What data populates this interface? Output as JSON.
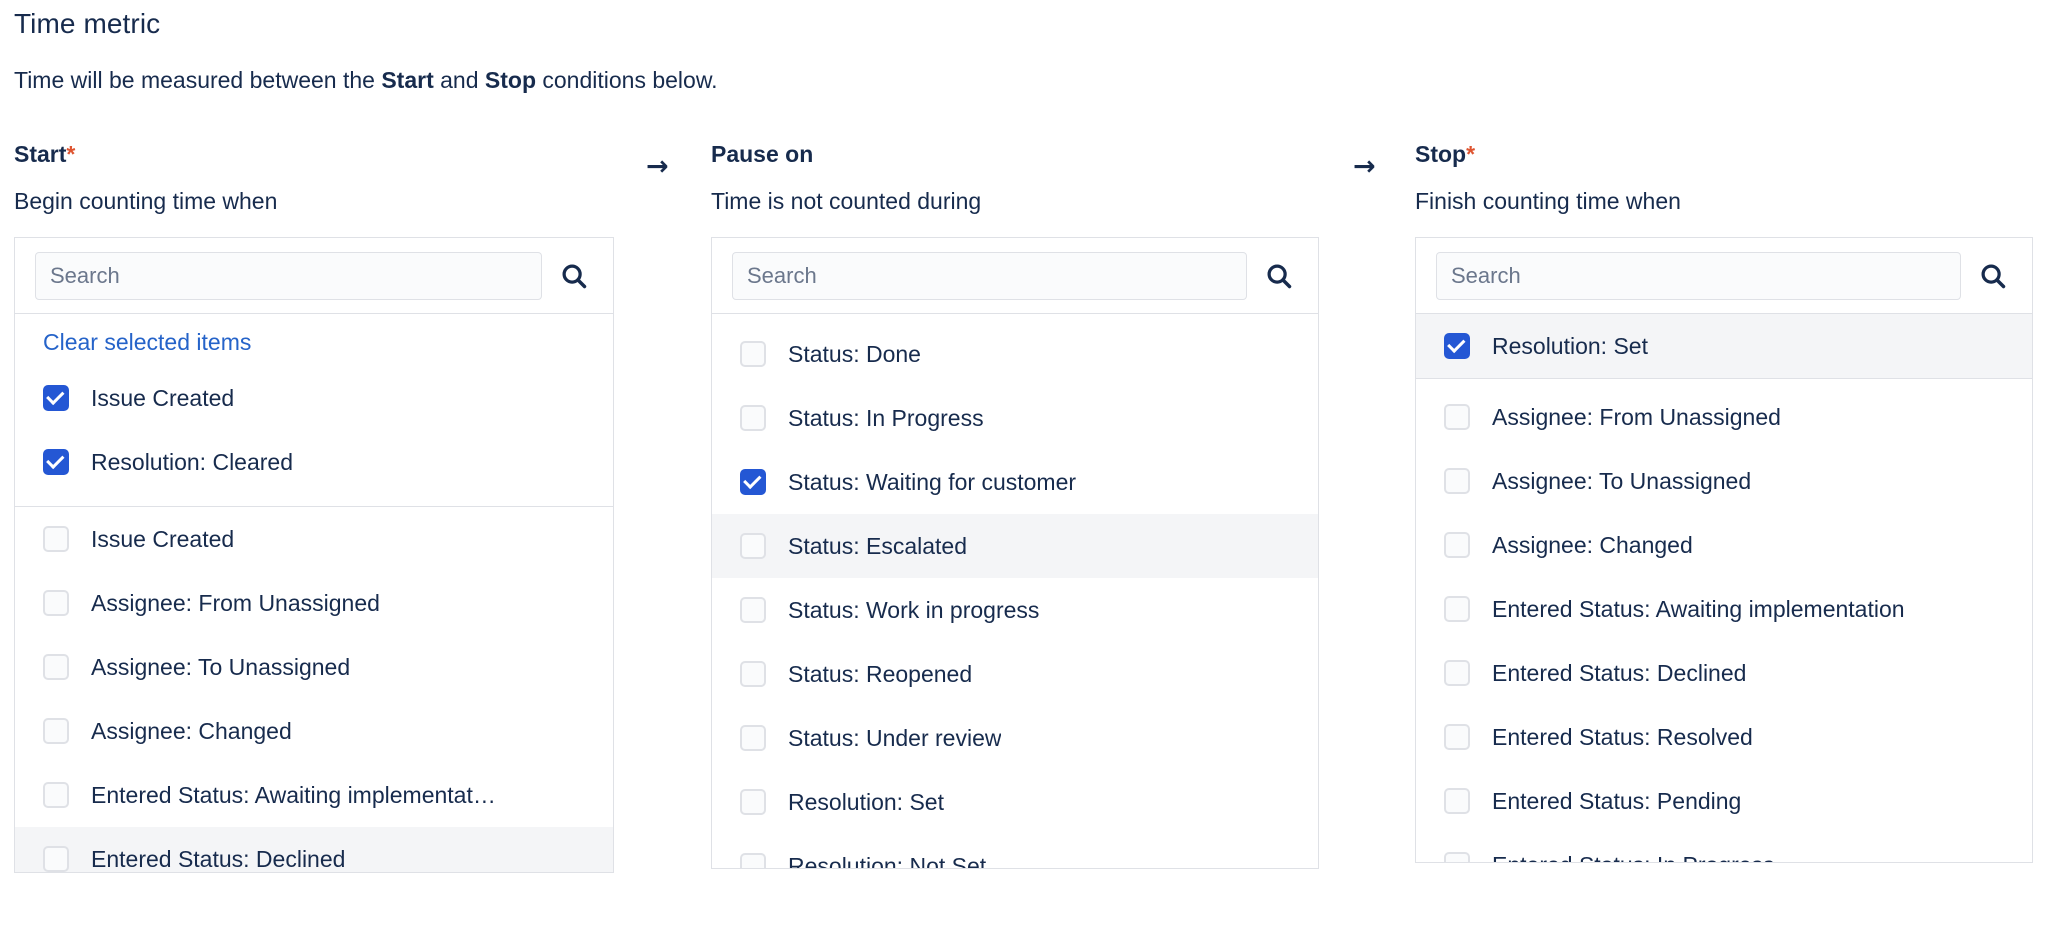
{
  "heading": {
    "title": "Time metric",
    "description_pre": "Time will be measured between the ",
    "description_bold1": "Start",
    "description_mid": " and ",
    "description_bold2": "Stop",
    "description_post": " conditions below."
  },
  "arrow_glyph": "→",
  "required_marker": "*",
  "colors": {
    "checkbox_checked": "#2457D4",
    "link": "#2563C9",
    "required": "#DE5430",
    "text": "#172B4D",
    "border": "#DFE1E6",
    "row_highlight": "#F4F5F7"
  },
  "columns": [
    {
      "title": "Start",
      "required": true,
      "subtitle": "Begin counting time when",
      "search": {
        "value": "",
        "placeholder": "Search",
        "icon": "search-icon"
      },
      "clear_label": "Clear selected items",
      "has_clear": true,
      "selected": [
        {
          "label": "Issue Created",
          "checked": true
        },
        {
          "label": "Resolution: Cleared",
          "checked": true
        }
      ],
      "options": [
        {
          "label": "Issue Created",
          "checked": false,
          "highlighted": false
        },
        {
          "label": "Assignee: From Unassigned",
          "checked": false,
          "highlighted": false
        },
        {
          "label": "Assignee: To Unassigned",
          "checked": false,
          "highlighted": false
        },
        {
          "label": "Assignee: Changed",
          "checked": false,
          "highlighted": false
        },
        {
          "label": "Entered Status: Awaiting implementat…",
          "checked": false,
          "highlighted": false
        },
        {
          "label": "Entered Status: Declined",
          "checked": false,
          "highlighted": true
        }
      ]
    },
    {
      "title": "Pause on",
      "required": false,
      "subtitle": "Time is not counted during",
      "search": {
        "value": "",
        "placeholder": "Search",
        "icon": "search-icon"
      },
      "clear_label": "Clear selected items",
      "has_clear": false,
      "selected": [],
      "options": [
        {
          "label": "Status: Done",
          "checked": false,
          "highlighted": false
        },
        {
          "label": "Status: In Progress",
          "checked": false,
          "highlighted": false
        },
        {
          "label": "Status: Waiting for customer",
          "checked": true,
          "highlighted": false
        },
        {
          "label": "Status: Escalated",
          "checked": false,
          "highlighted": true
        },
        {
          "label": "Status: Work in progress",
          "checked": false,
          "highlighted": false
        },
        {
          "label": "Status: Reopened",
          "checked": false,
          "highlighted": false
        },
        {
          "label": "Status: Under review",
          "checked": false,
          "highlighted": false
        },
        {
          "label": "Resolution: Set",
          "checked": false,
          "highlighted": false
        },
        {
          "label": "Resolution: Not Set",
          "checked": false,
          "highlighted": false
        }
      ]
    },
    {
      "title": "Stop",
      "required": true,
      "subtitle": "Finish counting time when",
      "search": {
        "value": "",
        "placeholder": "Search",
        "icon": "search-icon"
      },
      "clear_label": "Clear selected items",
      "has_clear": false,
      "selected": [
        {
          "label": "Resolution: Set",
          "checked": true
        }
      ],
      "options": [
        {
          "label": "Assignee: From Unassigned",
          "checked": false,
          "highlighted": false
        },
        {
          "label": "Assignee: To Unassigned",
          "checked": false,
          "highlighted": false
        },
        {
          "label": "Assignee: Changed",
          "checked": false,
          "highlighted": false
        },
        {
          "label": "Entered Status: Awaiting implementation",
          "checked": false,
          "highlighted": false
        },
        {
          "label": "Entered Status: Declined",
          "checked": false,
          "highlighted": false
        },
        {
          "label": "Entered Status: Resolved",
          "checked": false,
          "highlighted": false
        },
        {
          "label": "Entered Status: Pending",
          "checked": false,
          "highlighted": false
        },
        {
          "label": "Entered Status: In Progress",
          "checked": false,
          "highlighted": false
        }
      ]
    }
  ]
}
